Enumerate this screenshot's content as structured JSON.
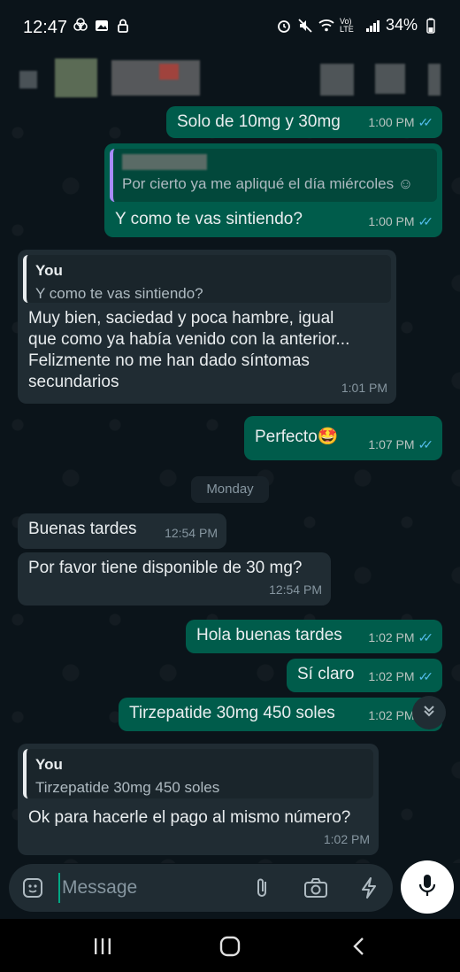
{
  "status_bar": {
    "time": "12:47",
    "network": "Vo) LTE",
    "battery": "34%"
  },
  "messages": [
    {
      "text": "Solo de 10mg y 30mg",
      "time": "1:00 PM"
    },
    {
      "quote_text": "Por cierto ya me apliqué el día miércoles ☺",
      "text": "Y como te vas sintiendo?",
      "time": "1:00 PM"
    },
    {
      "quote_name": "You",
      "quote_text": "Y como te vas sintiendo?",
      "lines": [
        "Muy bien, saciedad y poca hambre, igual",
        "que como ya había venido con la anterior...",
        "Felizmente no me han dado síntomas",
        "secundarios"
      ],
      "time": "1:01 PM"
    },
    {
      "text": "Perfecto",
      "emoji": "🤩",
      "time": "1:07 PM"
    },
    {
      "text": "Buenas tardes",
      "time": "12:54 PM"
    },
    {
      "text": "Por favor tiene disponible de 30 mg?",
      "time": "12:54 PM"
    },
    {
      "text": "Hola buenas tardes",
      "time": "1:02 PM"
    },
    {
      "text": "Sí claro",
      "time": "1:02 PM"
    },
    {
      "text": "Tirzepatide 30mg 450 soles",
      "time": "1:02 PM"
    },
    {
      "quote_name": "You",
      "quote_text": "Tirzepatide 30mg 450 soles",
      "text": "Ok para hacerle el pago al mismo número?",
      "time": "1:02 PM"
    }
  ],
  "date_separator": "Monday",
  "composer": {
    "placeholder": "Message"
  },
  "icons": {
    "sticker": "sticker-icon",
    "attach": "paperclip-icon",
    "camera": "camera-icon",
    "quick": "lightning-icon",
    "mic": "mic-icon",
    "scroll": "double-chevron-down-icon"
  },
  "colors": {
    "outgoing_bubble": "#005c4b",
    "incoming_bubble": "#202c33",
    "read_ticks": "#53bdeb",
    "background": "#0b141a"
  }
}
